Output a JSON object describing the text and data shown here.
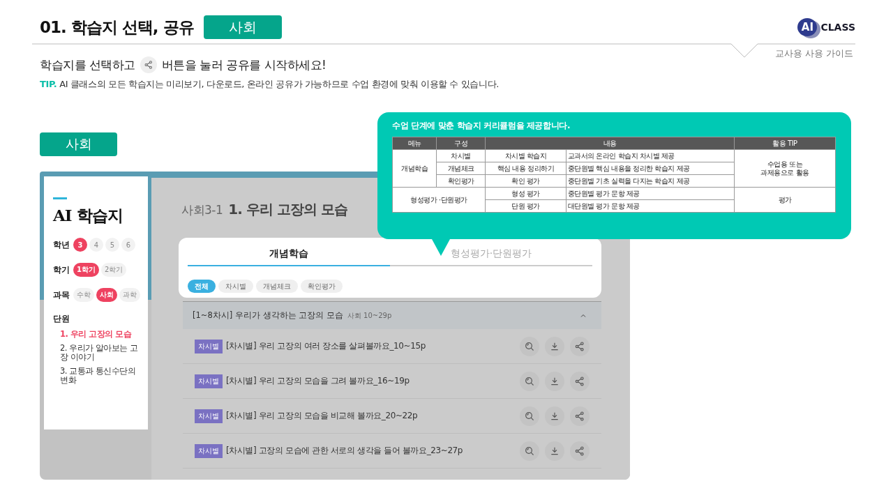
{
  "header": {
    "title": "01. 학습지 선택, 공유",
    "badge": "사회",
    "logo_mark": "AI",
    "logo_text": "CLASS",
    "guide": "교사용 사용 가이드"
  },
  "intro": {
    "before": "학습지를 선택하고",
    "after": "버튼을 눌러 공유를 시작하세요!",
    "tip_label": "TIP.",
    "tip": "AI 클래스의 모든 학습지는 미리보기, 다운로드, 온라인 공유가 가능하므로 수업 환경에 맞춰 이용할 수 있습니다."
  },
  "section_badge": "사회",
  "sidebar": {
    "title": "AI 학습지",
    "filters": [
      {
        "label": "학년",
        "options": [
          {
            "label": "3",
            "selected": true
          },
          {
            "label": "4",
            "selected": false
          },
          {
            "label": "5",
            "selected": false
          },
          {
            "label": "6",
            "selected": false
          }
        ]
      },
      {
        "label": "학기",
        "options": [
          {
            "label": "1학기",
            "selected": true
          },
          {
            "label": "2학기",
            "selected": false
          }
        ]
      },
      {
        "label": "과목",
        "options": [
          {
            "label": "수학",
            "selected": false
          },
          {
            "label": "사회",
            "selected": true
          },
          {
            "label": "과학",
            "selected": false
          }
        ]
      }
    ],
    "unit_label": "단원",
    "units": [
      {
        "label": "1. 우리 고장의 모습",
        "selected": true
      },
      {
        "label": "2. 우리가 알아보는 고장 이야기",
        "selected": false
      },
      {
        "label": "3. 교통과 통신수단의 변화",
        "selected": false
      }
    ]
  },
  "main": {
    "code": "사회3-1",
    "title": "1. 우리 고장의 모습",
    "tabs": [
      {
        "label": "개념학습",
        "selected": true
      },
      {
        "label": "형성평가·단원평가",
        "selected": false
      }
    ],
    "chips": [
      {
        "label": "전체",
        "selected": true
      },
      {
        "label": "차시별",
        "selected": false
      },
      {
        "label": "개념체크",
        "selected": false
      },
      {
        "label": "확인평가",
        "selected": false
      }
    ],
    "section": {
      "title": "[1~8차시] 우리가 생각하는 고장의 모습",
      "pages": "사회 10~29p",
      "expanded": true
    },
    "rows": [
      {
        "tag": "차시별",
        "title": "[차시별] 우리 고장의 여러 장소를 살펴볼까요_10~15p"
      },
      {
        "tag": "차시별",
        "title": "[차시별] 우리 고장의 모습을 그려 볼까요_16~19p"
      },
      {
        "tag": "차시별",
        "title": "[차시별] 우리 고장의 모습을 비교해 볼까요_20~22p"
      },
      {
        "tag": "차시별",
        "title": "[차시별] 고장의 모습에 관한 서로의 생각을 들어 볼까요_23~27p"
      }
    ]
  },
  "callout": {
    "title": "수업 단계에 맞춘 학습지 커리큘럼을 제공합니다.",
    "columns": [
      "메뉴",
      "구성",
      "내용",
      "활용 TIP"
    ],
    "groups": [
      {
        "kind": "split",
        "menu": "개념학습",
        "tip": "수업용 또는\n과제용으로 활용",
        "rows": [
          {
            "part": "차시별",
            "name": "차시별 학습지",
            "description": "교과서의 온라인 학습지 차시별 제공"
          },
          {
            "part": "개념체크",
            "name": "핵심 내용 정리하기",
            "description": "중단원별 핵심 내용을 정리한 학습지 제공"
          },
          {
            "part": "확인평가",
            "name": "확인 평가",
            "description": "중단원별 기초 실력을 다지는 학습지 제공"
          }
        ]
      },
      {
        "kind": "wide",
        "menu": "형성평가 ·단원평가",
        "tip": "평가",
        "rows": [
          {
            "name": "형성 평가",
            "description": "중단원별 평가 문항 제공"
          },
          {
            "name": "단원 평가",
            "description": "대단원별 평가 문항 제공"
          }
        ]
      }
    ]
  }
}
